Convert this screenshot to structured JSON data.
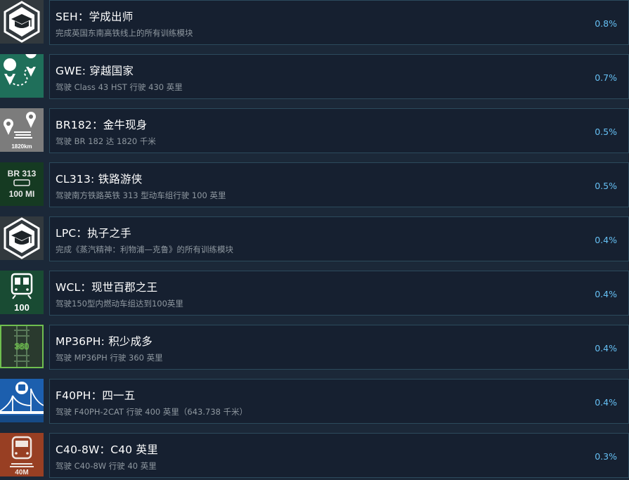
{
  "achievements": [
    {
      "title": "SEH：学成出师",
      "description": "完成英国东南高铁线上的所有训练模块",
      "percent": "0.8%",
      "icon": "graduation-cap-badge-icon",
      "icon_text": ""
    },
    {
      "title": "GWE: 穿越国家",
      "description": "驾驶 Class 43 HST 行驶 430 英里",
      "percent": "0.7%",
      "icon": "map-route-pins-icon",
      "icon_text": ""
    },
    {
      "title": "BR182：金牛现身",
      "description": "驾驶 BR 182 达 1820 千米",
      "percent": "0.5%",
      "icon": "distance-pins-icon",
      "icon_text": "1820km"
    },
    {
      "title": "CL313: 铁路游侠",
      "description": "驾驶南方铁路英铁 313 型动车组行驶 100 英里",
      "percent": "0.5%",
      "icon": "br313-mileage-icon",
      "icon_text": "BR 313\n100 MI"
    },
    {
      "title": "LPC：执子之手",
      "description": "完成《蒸汽精神：利物浦—克鲁》的所有训练模块",
      "percent": "0.4%",
      "icon": "graduation-cap-badge-icon",
      "icon_text": ""
    },
    {
      "title": "WCL：现世百郡之王",
      "description": "驾驶150型内燃动车组达到100英里",
      "percent": "0.4%",
      "icon": "dmu-train-front-icon",
      "icon_text": "100"
    },
    {
      "title": "MP36PH: 积少成多",
      "description": "驾驶 MP36PH 行驶 360 英里",
      "percent": "0.4%",
      "icon": "track-360-icon",
      "icon_text": "360"
    },
    {
      "title": "F40PH：四一五",
      "description": "驾驶 F40PH-2CAT 行驶 400 英里（643.738 千米）",
      "percent": "0.4%",
      "icon": "bridge-train-icon",
      "icon_text": ""
    },
    {
      "title": "C40-8W：C40 英里",
      "description": "驾驶 C40-8W 行驶 40 英里",
      "percent": "0.3%",
      "icon": "locomotive-40m-icon",
      "icon_text": "40M"
    }
  ]
}
